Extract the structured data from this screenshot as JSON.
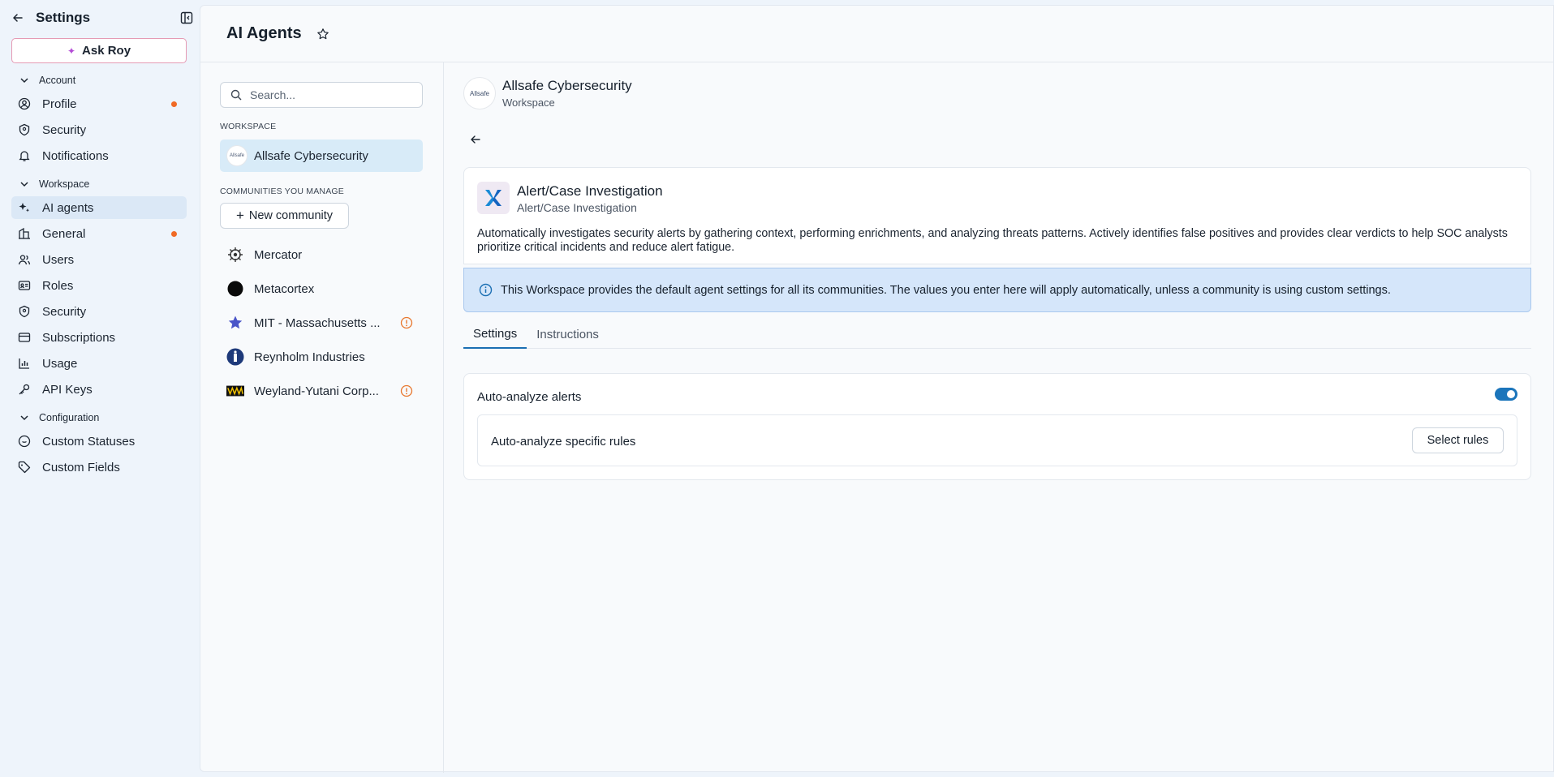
{
  "sidebar": {
    "title": "Settings",
    "ask_roy": "Ask Roy",
    "sections": {
      "account": "Account",
      "workspace": "Workspace",
      "configuration": "Configuration"
    },
    "items": {
      "profile": "Profile",
      "security_account": "Security",
      "notifications": "Notifications",
      "ai_agents": "AI agents",
      "general": "General",
      "users": "Users",
      "roles": "Roles",
      "security_workspace": "Security",
      "subscriptions": "Subscriptions",
      "usage": "Usage",
      "api_keys": "API Keys",
      "custom_statuses": "Custom Statuses",
      "custom_fields": "Custom Fields"
    }
  },
  "header": {
    "title": "AI Agents"
  },
  "communities_panel": {
    "search_placeholder": "Search...",
    "workspace_label": "WORKSPACE",
    "workspace_name": "Allsafe Cybersecurity",
    "communities_label": "COMMUNITIES YOU MANAGE",
    "new_community": "New community",
    "communities": [
      {
        "name": "Mercator"
      },
      {
        "name": "Metacortex"
      },
      {
        "name": "MIT - Massachusetts ..."
      },
      {
        "name": "Reynholm Industries"
      },
      {
        "name": "Weyland-Yutani Corp..."
      }
    ]
  },
  "logo_text": "Allsafe",
  "detail": {
    "workspace_name": "Allsafe Cybersecurity",
    "workspace_type": "Workspace",
    "agent": {
      "title": "Alert/Case Investigation",
      "subtitle": "Alert/Case Investigation",
      "description": "Automatically investigates security alerts by gathering context, performing enrichments, and analyzing threats patterns. Actively identifies false positives and provides clear verdicts to help SOC analysts prioritize critical incidents and reduce alert fatigue."
    },
    "info_banner": "This Workspace provides the default agent settings for all its communities. The values you enter here will apply automatically, unless a community is using custom settings.",
    "tabs": {
      "settings": "Settings",
      "instructions": "Instructions"
    },
    "settings": {
      "auto_analyze_label": "Auto-analyze alerts",
      "auto_analyze_enabled": true,
      "specific_rules_label": "Auto-analyze specific rules",
      "select_rules_button": "Select rules"
    }
  },
  "colors": {
    "accent": "#1b75bb",
    "notification_dot": "#f06a25",
    "info_bg": "#d5e6fa",
    "warning_icon": "#e8772e"
  }
}
